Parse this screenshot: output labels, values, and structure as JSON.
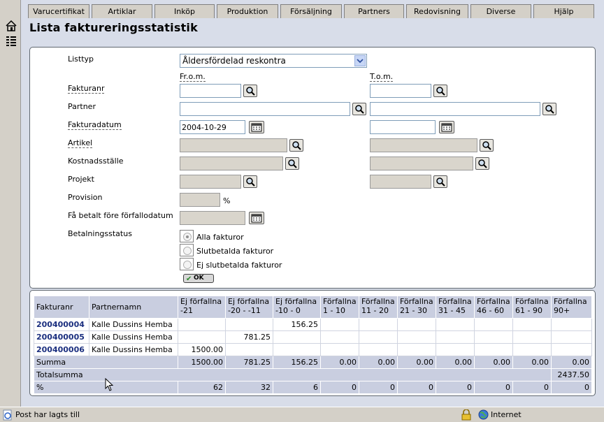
{
  "tabs": [
    "Varucertifikat",
    "Artiklar",
    "Inköp",
    "Produktion",
    "Försäljning",
    "Partners",
    "Redovisning",
    "Diverse",
    "Hjälp"
  ],
  "page_title": "Lista faktureringsstatistik",
  "form": {
    "listtyp_label": "Listtyp",
    "listtyp_value": "Åldersfördelad reskontra",
    "from_label": "Fr.o.m.",
    "tom_label": "T.o.m.",
    "fakturanr_label": "Fakturanr",
    "partner_label": "Partner",
    "fakturadatum_label": "Fakturadatum",
    "fakturadatum_from": "2004-10-29",
    "artikel_label": "Artikel",
    "kostnadsstalle_label": "Kostnadsställe",
    "projekt_label": "Projekt",
    "provision_label": "Provision",
    "provision_unit": "%",
    "betalt_fore_label": "Få betalt före förfallodatum",
    "betalningsstatus_label": "Betalningsstatus",
    "radio_options": [
      "Alla fakturor",
      "Slutbetalda fakturor",
      "Ej slutbetalda fakturor"
    ],
    "ok_label": "OK"
  },
  "table": {
    "headers": [
      "Fakturanr",
      "Partnernamn",
      "Ej förfallna -21",
      "Ej förfallna -20 - -11",
      "Ej förfallna -10 - 0",
      "Förfallna 1 - 10",
      "Förfallna 11 - 20",
      "Förfallna 21 - 30",
      "Förfallna 31 - 45",
      "Förfallna 46 - 60",
      "Förfallna 61 - 90",
      "Förfallna 90+"
    ],
    "rows": [
      {
        "fakturanr": "200400004",
        "partner": "Kalle Dussins Hemba",
        "values": [
          "",
          "",
          "156.25",
          "",
          "",
          "",
          "",
          "",
          "",
          ""
        ]
      },
      {
        "fakturanr": "200400005",
        "partner": "Kalle Dussins Hemba",
        "values": [
          "",
          "781.25",
          "",
          "",
          "",
          "",
          "",
          "",
          "",
          ""
        ]
      },
      {
        "fakturanr": "200400006",
        "partner": "Kalle Dussins Hemba",
        "values": [
          "1500.00",
          "",
          "",
          "",
          "",
          "",
          "",
          "",
          "",
          ""
        ]
      }
    ],
    "summa_label": "Summa",
    "summa_values": [
      "1500.00",
      "781.25",
      "156.25",
      "0.00",
      "0.00",
      "0.00",
      "0.00",
      "0.00",
      "0.00",
      "0.00"
    ],
    "totalsumma_label": "Totalsumma",
    "totalsumma_value": "2437.50",
    "percent_label": "%",
    "percent_values": [
      "62",
      "32",
      "6",
      "0",
      "0",
      "0",
      "0",
      "0",
      "0",
      "0"
    ]
  },
  "statusbar": {
    "text": "Post har lagts till",
    "zone": "Internet"
  }
}
